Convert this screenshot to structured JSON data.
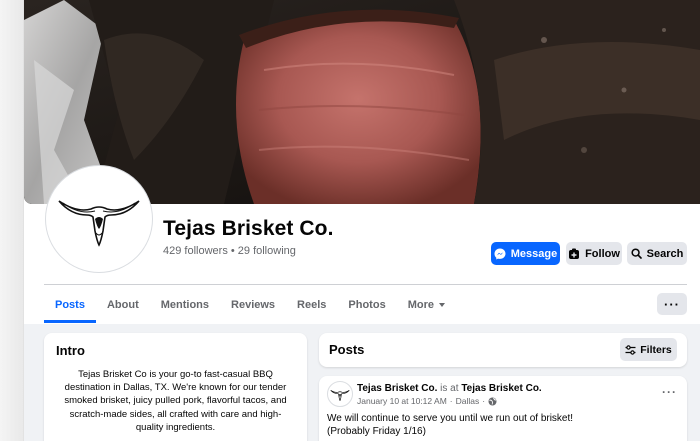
{
  "page": {
    "name": "Tejas Brisket Co.",
    "follow_stats": "429 followers • 29 following"
  },
  "actions": {
    "message_label": "Message",
    "follow_label": "Follow",
    "search_label": "Search"
  },
  "tabs": [
    {
      "label": "Posts",
      "active": true
    },
    {
      "label": "About"
    },
    {
      "label": "Mentions"
    },
    {
      "label": "Reviews"
    },
    {
      "label": "Reels"
    },
    {
      "label": "Photos"
    },
    {
      "label": "More"
    }
  ],
  "more_menu_label": "···",
  "intro": {
    "title": "Intro",
    "text": "Tejas Brisket Co is your go-to fast-casual BBQ destination in Dallas, TX. We're known for our tender smoked brisket, juicy pulled pork, flavorful tacos, and scratch-made sides, all crafted with care and high-quality ingredients."
  },
  "posts_section": {
    "title": "Posts",
    "filters_label": "Filters"
  },
  "post": {
    "author": "Tejas Brisket Co.",
    "connector": " is at ",
    "location": "Tejas Brisket Co.",
    "timestamp": "January 10 at 10:12 AM",
    "place": "Dallas",
    "menu_label": "···",
    "line1": "We will continue to serve you until we run out of brisket!",
    "line2": "(Probably Friday 1/16)"
  },
  "colors": {
    "accent": "#0866ff",
    "secondary_button": "#e4e6eb",
    "page_bg": "#f0f2f5",
    "muted_text": "#65676b"
  },
  "icons": [
    "messenger-icon",
    "follow-icon",
    "search-icon",
    "chevron-down-icon",
    "filters-icon",
    "globe-icon",
    "longhorn-logo"
  ]
}
